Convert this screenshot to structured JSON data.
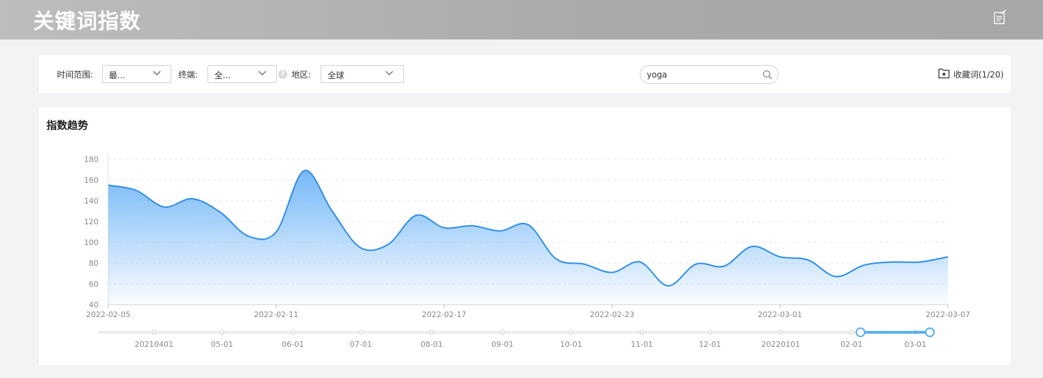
{
  "header": {
    "title": "关键词指数",
    "edit_icon": "edit-note-icon"
  },
  "filters": {
    "time_label": "时间范围:",
    "time_value": "最...",
    "device_label": "终端:",
    "device_value": "全...",
    "region_label": "地区:",
    "region_value": "全球",
    "help_icon": "help-icon",
    "search_value": "yoga",
    "favorites_label": "收藏词(1/20)"
  },
  "chart_title": "指数趋势",
  "colors": {
    "line": "#2b8de8",
    "fill_top": "#6fb4f7",
    "slider": "#5ab1ef"
  },
  "chart_data": {
    "type": "area",
    "title": "",
    "xlabel": "",
    "ylabel": "",
    "ylim": [
      40,
      180
    ],
    "y_ticks": [
      40,
      60,
      80,
      100,
      120,
      140,
      160,
      180
    ],
    "grid": true,
    "x": [
      "2022-02-05",
      "2022-02-06",
      "2022-02-07",
      "2022-02-08",
      "2022-02-09",
      "2022-02-10",
      "2022-02-11",
      "2022-02-12",
      "2022-02-13",
      "2022-02-14",
      "2022-02-15",
      "2022-02-16",
      "2022-02-17",
      "2022-02-18",
      "2022-02-19",
      "2022-02-20",
      "2022-02-21",
      "2022-02-22",
      "2022-02-23",
      "2022-02-24",
      "2022-02-25",
      "2022-02-26",
      "2022-02-27",
      "2022-02-28",
      "2022-03-01",
      "2022-03-02",
      "2022-03-03",
      "2022-03-04",
      "2022-03-05",
      "2022-03-06",
      "2022-03-07"
    ],
    "x_tick_labels": [
      "2022-02-05",
      "2022-02-11",
      "2022-02-17",
      "2022-02-23",
      "2022-03-01",
      "2022-03-07"
    ],
    "series": [
      {
        "values": [
          155,
          150,
          134,
          142,
          129,
          106,
          110,
          169,
          130,
          95,
          98,
          126,
          114,
          116,
          111,
          117,
          84,
          79,
          71,
          81,
          58,
          79,
          77,
          96,
          86,
          83,
          67,
          78,
          81,
          81,
          86
        ]
      }
    ],
    "data_zoom": {
      "labels": [
        "20210401",
        "05-01",
        "06-01",
        "07-01",
        "08-01",
        "09-01",
        "10-01",
        "11-01",
        "12-01",
        "20220101",
        "02-01",
        "03-01"
      ],
      "range_start": "2022-02-05",
      "range_end": "2022-03-07"
    }
  }
}
